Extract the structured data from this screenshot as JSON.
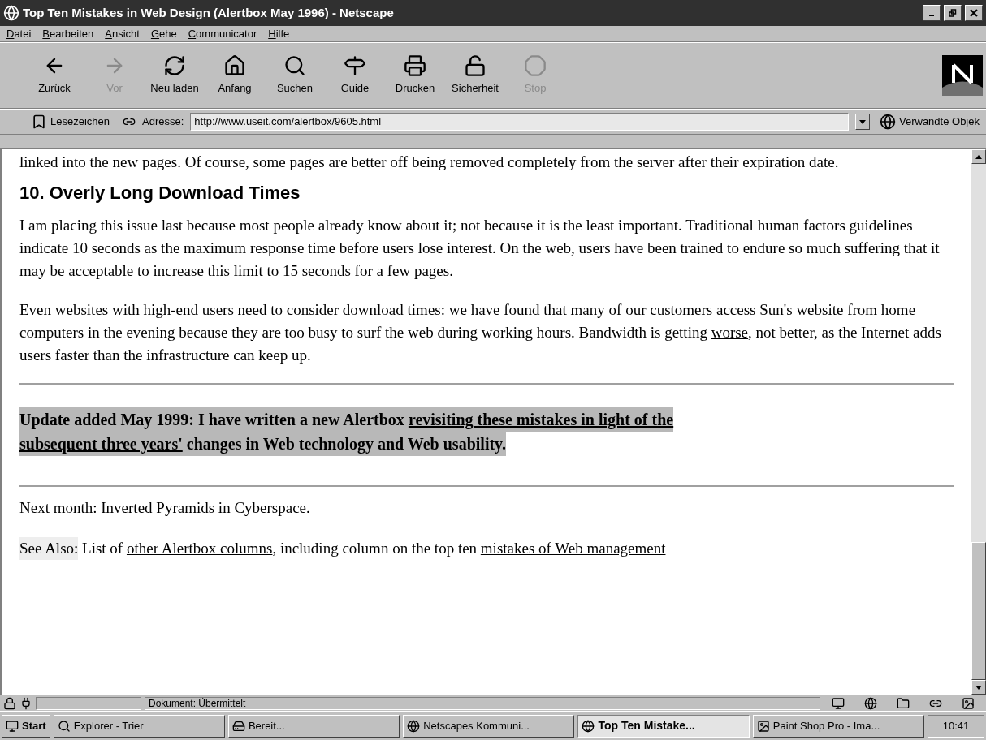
{
  "window": {
    "title": "Top Ten Mistakes in Web Design (Alertbox May 1996) - Netscape"
  },
  "menu": [
    "Datei",
    "Bearbeiten",
    "Ansicht",
    "Gehe",
    "Communicator",
    "Hilfe"
  ],
  "toolbar": [
    {
      "label": "Zurück",
      "disabled": false
    },
    {
      "label": "Vor",
      "disabled": true
    },
    {
      "label": "Neu laden",
      "disabled": false
    },
    {
      "label": "Anfang",
      "disabled": false
    },
    {
      "label": "Suchen",
      "disabled": false
    },
    {
      "label": "Guide",
      "disabled": false
    },
    {
      "label": "Drucken",
      "disabled": false
    },
    {
      "label": "Sicherheit",
      "disabled": false
    },
    {
      "label": "Stop",
      "disabled": true
    }
  ],
  "location": {
    "bookmarks": "Lesezeichen",
    "address_label": "Adresse:",
    "url": "http://www.useit.com/alertbox/9605.html",
    "related": "Verwandte Objek"
  },
  "content": {
    "top_fragment": "linked into the new pages. Of course, some pages are better off being removed completely from the server after their expiration date.",
    "heading": "10. Overly Long Download Times",
    "paragraphs": [
      [
        {
          "text": "I am placing this issue last because most people already know about it; not because it is the least important. Traditional human factors guidelines indicate 10 seconds as the maximum response time before users lose interest. On the web, users have been trained to endure so much suffering that it may be acceptable to increase this limit to 15 seconds for a few pages.",
          "kind": "text"
        }
      ],
      [
        {
          "text": "Even websites with high-end users need to consider ",
          "kind": "text"
        },
        {
          "text": "download times",
          "kind": "link"
        },
        {
          "text": ": we have found that many of our customers access Sun's website from home computers in the evening because they are too busy to surf the web during working hours. Bandwidth is getting ",
          "kind": "text"
        },
        {
          "text": "worse",
          "kind": "link"
        },
        {
          "text": ", not better, as the Internet adds users faster than the infrastructure can keep up.",
          "kind": "text"
        }
      ]
    ],
    "update_lines": [
      [
        {
          "text": "Update added May 1999: I have written a new Alertbox ",
          "kind": "text"
        },
        {
          "text": "revisiting these mistakes in light of the",
          "kind": "link"
        }
      ],
      [
        {
          "text": "subsequent three years'",
          "kind": "link"
        },
        {
          "text": " changes in Web technology and Web usability.",
          "kind": "text"
        }
      ]
    ],
    "next_month": [
      {
        "text": "Next month: ",
        "kind": "text"
      },
      {
        "text": "Inverted Pyramids",
        "kind": "link"
      },
      {
        "text": " in Cyberspace.",
        "kind": "text"
      }
    ],
    "see_also_label": "See Also:",
    "see_also": [
      {
        "text": " List of ",
        "kind": "text"
      },
      {
        "text": "other Alertbox columns",
        "kind": "link"
      },
      {
        "text": ", including column on the top ten ",
        "kind": "text"
      },
      {
        "text": "mistakes of Web management",
        "kind": "link"
      }
    ]
  },
  "status_bar": {
    "text": "Dokument: Übermittelt"
  },
  "taskbar": {
    "start": "Start",
    "tasks": [
      {
        "label": "Explorer - Trier",
        "selected": false
      },
      {
        "label": "Bereit...",
        "selected": false
      },
      {
        "label": "Netscapes Kommuni...",
        "selected": false
      },
      {
        "label": "Top Ten Mistake...",
        "selected": true
      },
      {
        "label": "Paint Shop Pro - Ima...",
        "selected": false
      }
    ],
    "clock": "10:41"
  }
}
